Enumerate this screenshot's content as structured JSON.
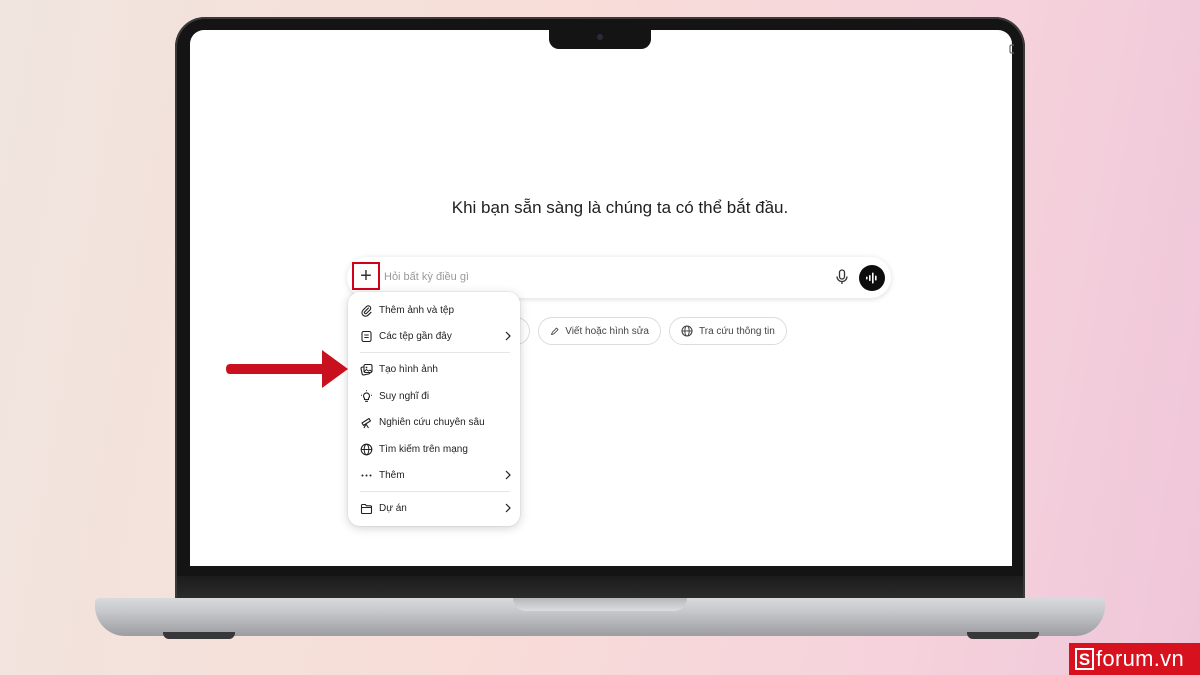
{
  "chat": {
    "headline": "Khi bạn sẵn sàng là chúng ta có thể bắt đầu.",
    "input_placeholder": "Hỏi bất kỳ điều gì",
    "plus_symbol": "+"
  },
  "suggestions": [
    {
      "label": "Viết hoặc hình sửa",
      "icon": "pencil-icon"
    },
    {
      "label": "Tra cứu thông tin",
      "icon": "globe-icon"
    }
  ],
  "menu": {
    "items": [
      {
        "label": "Thêm ảnh và tệp",
        "icon": "paperclip-icon",
        "has_submenu": false
      },
      {
        "label": "Các tệp gần đây",
        "icon": "file-icon",
        "has_submenu": true
      },
      {
        "label": "Tạo hình ảnh",
        "icon": "image-icon",
        "has_submenu": false
      },
      {
        "label": "Suy nghĩ đi",
        "icon": "lightbulb-icon",
        "has_submenu": false
      },
      {
        "label": "Nghiên cứu chuyên sâu",
        "icon": "telescope-icon",
        "has_submenu": false
      },
      {
        "label": "Tìm kiếm trên mạng",
        "icon": "globe-icon",
        "has_submenu": false
      },
      {
        "label": "Thêm",
        "icon": "more-dots-icon",
        "has_submenu": true
      },
      {
        "label": "Dự án",
        "icon": "folder-icon",
        "has_submenu": true
      }
    ]
  },
  "brand": {
    "mark": "S",
    "text": "forum.vn",
    "color": "#d7111e"
  },
  "colors": {
    "highlight": "#d0021b",
    "arrow": "#c8101e"
  }
}
